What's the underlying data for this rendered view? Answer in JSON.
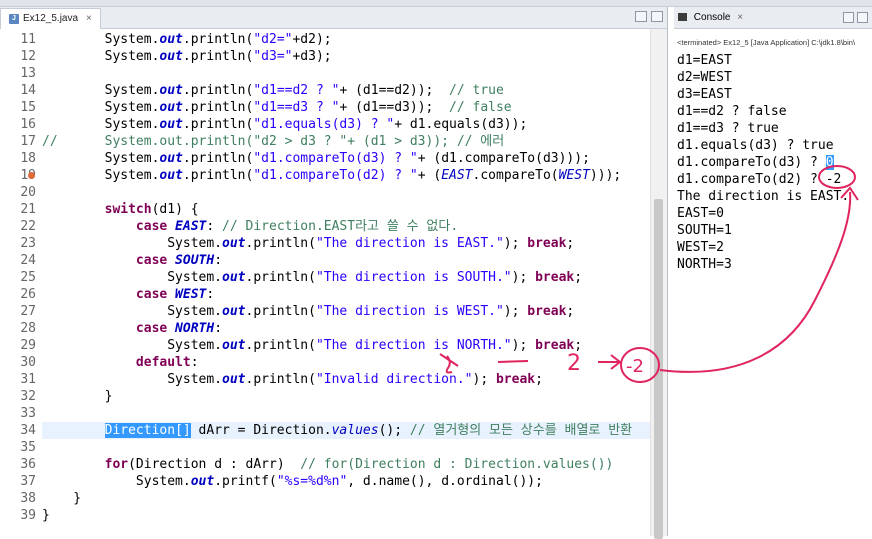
{
  "editor": {
    "tab_label": "Ex12_5.java",
    "lines": [
      {
        "n": "11",
        "segs": [
          [
            "",
            "        System."
          ],
          [
            "fld",
            "out"
          ],
          [
            "",
            ".println("
          ],
          [
            "str",
            "\"d2=\""
          ],
          [
            "",
            "+d2);"
          ]
        ]
      },
      {
        "n": "12",
        "segs": [
          [
            "",
            "        System."
          ],
          [
            "fld",
            "out"
          ],
          [
            "",
            ".println("
          ],
          [
            "str",
            "\"d3=\""
          ],
          [
            "",
            "+d3);"
          ]
        ]
      },
      {
        "n": "13",
        "segs": []
      },
      {
        "n": "14",
        "segs": [
          [
            "",
            "        System."
          ],
          [
            "fld",
            "out"
          ],
          [
            "",
            ".println("
          ],
          [
            "str",
            "\"d1==d2 ? \""
          ],
          [
            "",
            "+ (d1==d2));  "
          ],
          [
            "cm",
            "// true"
          ]
        ]
      },
      {
        "n": "15",
        "segs": [
          [
            "",
            "        System."
          ],
          [
            "fld",
            "out"
          ],
          [
            "",
            ".println("
          ],
          [
            "str",
            "\"d1==d3 ? \""
          ],
          [
            "",
            "+ (d1==d3));  "
          ],
          [
            "cm",
            "// false"
          ]
        ]
      },
      {
        "n": "16",
        "segs": [
          [
            "",
            "        System."
          ],
          [
            "fld",
            "out"
          ],
          [
            "",
            ".println("
          ],
          [
            "str",
            "\"d1.equals(d3) ? \""
          ],
          [
            "",
            "+ d1.equals(d3));"
          ]
        ]
      },
      {
        "n": "17",
        "segs": [
          [
            "cm",
            "//      System.out.println(\"d2 > d3 ? \"+ (d1 > d3)); // 에러"
          ]
        ]
      },
      {
        "n": "18",
        "segs": [
          [
            "",
            "        System."
          ],
          [
            "fld",
            "out"
          ],
          [
            "",
            ".println("
          ],
          [
            "str",
            "\"d1.compareTo(d3) ? \""
          ],
          [
            "",
            "+ (d1.compareTo(d3)));"
          ]
        ]
      },
      {
        "n": "19",
        "segs": [
          [
            "",
            "        System."
          ],
          [
            "fld",
            "out"
          ],
          [
            "",
            ".println("
          ],
          [
            "str",
            "\"d1.compareTo(d2) ? \""
          ],
          [
            "",
            "+ ("
          ],
          [
            "enm",
            "EAST"
          ],
          [
            "",
            ".compareTo("
          ],
          [
            "enm",
            "WEST"
          ],
          [
            "",
            "))); "
          ]
        ]
      },
      {
        "n": "20",
        "segs": []
      },
      {
        "n": "21",
        "segs": [
          [
            "",
            "        "
          ],
          [
            "kw",
            "switch"
          ],
          [
            "",
            "(d1) {"
          ]
        ]
      },
      {
        "n": "22",
        "segs": [
          [
            "",
            "            "
          ],
          [
            "kw",
            "case"
          ],
          [
            "",
            ""
          ],
          [
            "fld",
            " EAST"
          ],
          [
            "",
            ": "
          ],
          [
            "cm",
            "// Direction.EAST라고 쓸 수 없다."
          ]
        ]
      },
      {
        "n": "23",
        "segs": [
          [
            "",
            "                System."
          ],
          [
            "fld",
            "out"
          ],
          [
            "",
            ".println("
          ],
          [
            "str",
            "\"The direction is EAST.\""
          ],
          [
            "",
            "); "
          ],
          [
            "kw",
            "break"
          ],
          [
            "",
            ";"
          ]
        ]
      },
      {
        "n": "24",
        "segs": [
          [
            "",
            "            "
          ],
          [
            "kw",
            "case"
          ],
          [
            "fld",
            " SOUTH"
          ],
          [
            "",
            ":"
          ]
        ]
      },
      {
        "n": "25",
        "segs": [
          [
            "",
            "                System."
          ],
          [
            "fld",
            "out"
          ],
          [
            "",
            ".println("
          ],
          [
            "str",
            "\"The direction is SOUTH.\""
          ],
          [
            "",
            "); "
          ],
          [
            "kw",
            "break"
          ],
          [
            "",
            ";"
          ]
        ]
      },
      {
        "n": "26",
        "segs": [
          [
            "",
            "            "
          ],
          [
            "kw",
            "case"
          ],
          [
            "fld",
            " WEST"
          ],
          [
            "",
            ":"
          ]
        ]
      },
      {
        "n": "27",
        "segs": [
          [
            "",
            "                System."
          ],
          [
            "fld",
            "out"
          ],
          [
            "",
            ".println("
          ],
          [
            "str",
            "\"The direction is WEST.\""
          ],
          [
            "",
            "); "
          ],
          [
            "kw",
            "break"
          ],
          [
            "",
            ";"
          ]
        ]
      },
      {
        "n": "28",
        "segs": [
          [
            "",
            "            "
          ],
          [
            "kw",
            "case"
          ],
          [
            "fld",
            " NORTH"
          ],
          [
            "",
            ":"
          ]
        ]
      },
      {
        "n": "29",
        "segs": [
          [
            "",
            "                System."
          ],
          [
            "fld",
            "out"
          ],
          [
            "",
            ".println("
          ],
          [
            "str",
            "\"The direction is NORTH.\""
          ],
          [
            "",
            "); "
          ],
          [
            "kw",
            "break"
          ],
          [
            "",
            ";"
          ]
        ]
      },
      {
        "n": "30",
        "segs": [
          [
            "",
            "            "
          ],
          [
            "kw",
            "default"
          ],
          [
            "",
            ":"
          ]
        ]
      },
      {
        "n": "31",
        "segs": [
          [
            "",
            "                System."
          ],
          [
            "fld",
            "out"
          ],
          [
            "",
            ".println("
          ],
          [
            "str",
            "\"Invalid direction.\""
          ],
          [
            "",
            "); "
          ],
          [
            "kw",
            "break"
          ],
          [
            "",
            ";"
          ]
        ]
      },
      {
        "n": "32",
        "segs": [
          [
            "",
            "        }"
          ]
        ]
      },
      {
        "n": "33",
        "segs": []
      },
      {
        "n": "34",
        "segs": [
          [
            "",
            "        "
          ],
          [
            "sel",
            "Direction[]"
          ],
          [
            "",
            " dArr = Direction."
          ],
          [
            "enm",
            "values"
          ],
          [
            "",
            "(); "
          ],
          [
            "cm",
            "// 열거형의 모든 상수를 배열로 반환"
          ]
        ]
      },
      {
        "n": "35",
        "segs": []
      },
      {
        "n": "36",
        "segs": [
          [
            "",
            "        "
          ],
          [
            "kw",
            "for"
          ],
          [
            "",
            "(Direction d : dArr)  "
          ],
          [
            "cm",
            "// for(Direction d : Direction.values())"
          ]
        ]
      },
      {
        "n": "37",
        "segs": [
          [
            "",
            "            System."
          ],
          [
            "fld",
            "out"
          ],
          [
            "",
            ".printf("
          ],
          [
            "str",
            "\"%s=%d%n\""
          ],
          [
            "",
            ", d.name(), d.ordinal());"
          ]
        ]
      },
      {
        "n": "38",
        "segs": [
          [
            "",
            "    }"
          ]
        ]
      },
      {
        "n": "39",
        "segs": [
          [
            "",
            "}"
          ]
        ]
      }
    ]
  },
  "console": {
    "title": "Console",
    "terminated": "<terminated> Ex12_5 [Java Application] C:\\jdk1.8\\bin\\",
    "lines": [
      {
        "t": "d1=EAST"
      },
      {
        "t": "d2=WEST"
      },
      {
        "t": "d3=EAST"
      },
      {
        "t": "d1==d2 ? false"
      },
      {
        "t": "d1==d3 ? true"
      },
      {
        "t": "d1.equals(d3) ? true"
      },
      {
        "t": "d1.compareTo(d3) ? ",
        "sel": "0"
      },
      {
        "t": "d1.compareTo(d2) ? -2"
      },
      {
        "t": "The direction is EAST."
      },
      {
        "t": "EAST=0"
      },
      {
        "t": "SOUTH=1"
      },
      {
        "t": "WEST=2"
      },
      {
        "t": "NORTH=3"
      }
    ]
  },
  "annotation": {
    "num_a": "2",
    "num_b": "-2"
  },
  "colors": {
    "keyword": "#7f0055",
    "string": "#2a00ff",
    "comment": "#3f7f5f",
    "field": "#0000c0",
    "selection": "#3399ff",
    "annotation": "#e0245e"
  }
}
